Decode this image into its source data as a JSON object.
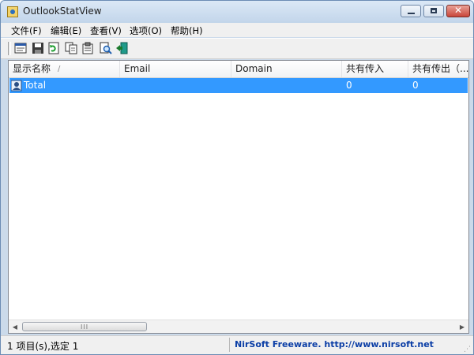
{
  "window": {
    "title": "OutlookStatView"
  },
  "menubar": {
    "items": [
      {
        "label": "文件(F)"
      },
      {
        "label": "编辑(E)"
      },
      {
        "label": "查看(V)"
      },
      {
        "label": "选项(O)"
      },
      {
        "label": "帮助(H)"
      }
    ]
  },
  "toolbar": {
    "buttons": [
      {
        "icon": "html-report-icon"
      },
      {
        "icon": "save-icon"
      },
      {
        "icon": "refresh-icon"
      },
      {
        "icon": "copy-icon"
      },
      {
        "icon": "properties-icon"
      },
      {
        "icon": "find-icon"
      },
      {
        "icon": "exit-icon"
      }
    ]
  },
  "list": {
    "columns": [
      {
        "label": "显示名称"
      },
      {
        "label": "Email"
      },
      {
        "label": "Domain"
      },
      {
        "label": "共有传入"
      },
      {
        "label": "共有传出（..."
      }
    ],
    "sort_indicator": "/",
    "rows": [
      {
        "name": "Total",
        "email": "",
        "domain": "",
        "total_incoming": "0",
        "total_outgoing": "0",
        "selected": true
      }
    ]
  },
  "scrollbar": {
    "grip": "III"
  },
  "status": {
    "items_selected": "1 项目(s),选定 1",
    "credit": "NirSoft Freeware.  http://www.nirsoft.net"
  },
  "colors": {
    "selection": "#3399ff",
    "credit_link": "#0b3ea6",
    "close_button": "#c9463a"
  }
}
